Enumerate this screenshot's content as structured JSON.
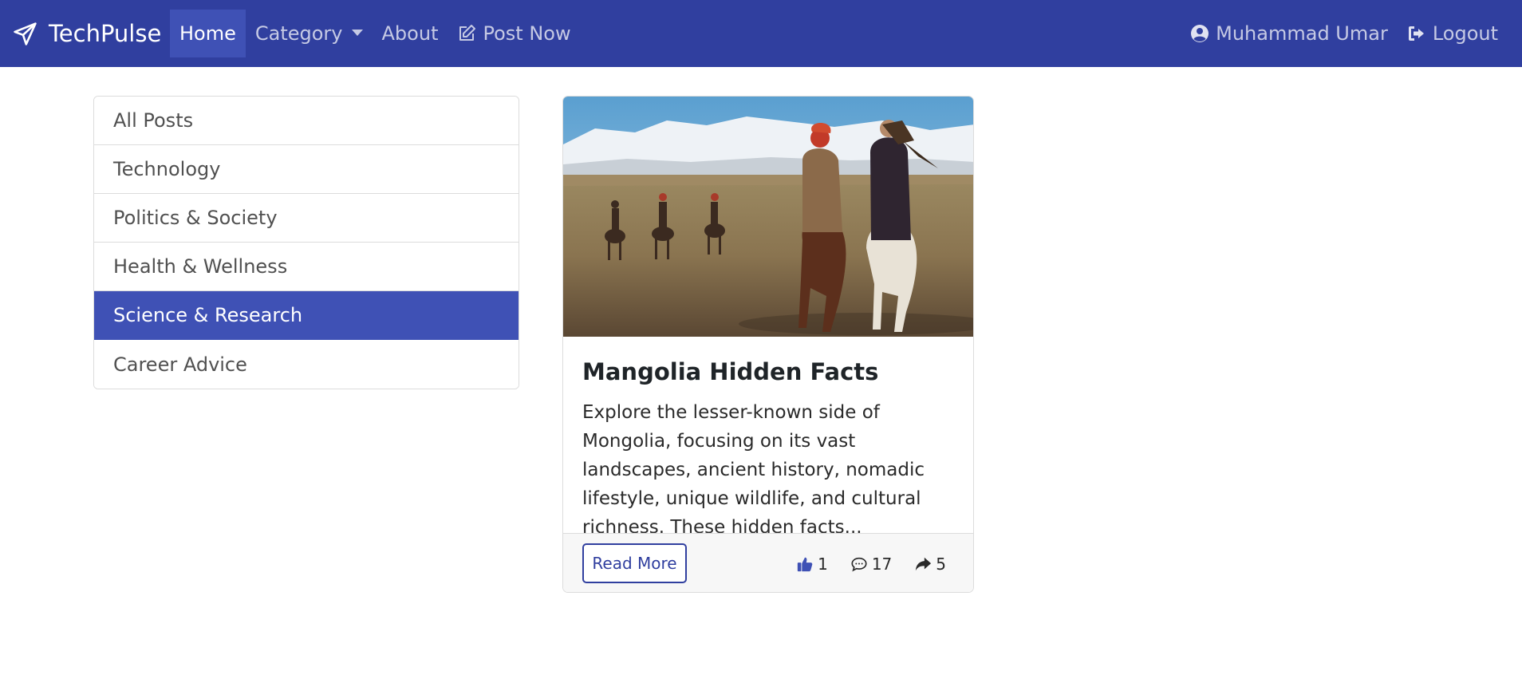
{
  "navbar": {
    "brand": "TechPulse",
    "items": [
      {
        "label": "Home",
        "active": true
      },
      {
        "label": "Category",
        "dropdown": true
      },
      {
        "label": "About"
      },
      {
        "label": "Post Now",
        "icon": "edit-icon"
      }
    ],
    "user": {
      "label": "Muhammad Umar",
      "icon": "user-circle-icon"
    },
    "logout": {
      "label": "Logout",
      "icon": "sign-out-icon"
    }
  },
  "sidebar": {
    "items": [
      {
        "label": "All Posts"
      },
      {
        "label": "Technology"
      },
      {
        "label": "Politics & Society"
      },
      {
        "label": "Health & Wellness"
      },
      {
        "label": "Science & Research",
        "active": true
      },
      {
        "label": "Career Advice"
      }
    ]
  },
  "post": {
    "title": "Mangolia Hidden Facts",
    "excerpt": "Explore the lesser-known side of Mongolia, focusing on its vast landscapes, ancient history, nomadic lifestyle, unique wildlife, and cultural richness. These hidden facts...",
    "read_more": "Read More",
    "likes": "1",
    "comments": "17",
    "shares": "5"
  },
  "colors": {
    "navbar": "#303f9f",
    "active": "#3f51b5",
    "like_icon": "#3f51b5"
  }
}
